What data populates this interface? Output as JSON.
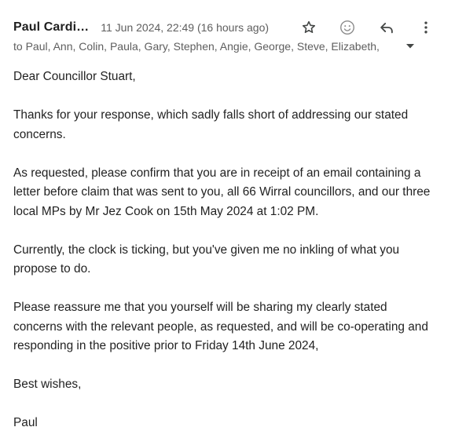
{
  "header": {
    "sender_name": "Paul Cardi…",
    "date": "11 Jun 2024, 22:49 (16 hours ago)",
    "recipients": "to Paul, Ann, Colin, Paula, Gary, Stephen, Angie, George, Steve, Elizabeth,",
    "icons": [
      "star-icon",
      "emoji-reaction-icon",
      "reply-icon",
      "more-options-icon",
      "chevron-down-icon"
    ]
  },
  "message": {
    "greeting": "Dear Councillor Stuart,",
    "paragraphs": [
      "Thanks for your response, which sadly falls short of addressing our stated concerns.",
      "As requested, please confirm that you are in receipt of an email containing a letter before claim that was sent to you, all 66 Wirral councillors, and our three local MPs by Mr Jez Cook on 15th May 2024 at 1:02 PM.",
      "Currently, the clock is ticking, but you've given me no inkling of what you propose to do.",
      "Please reassure me that you yourself will be sharing my clearly stated concerns with the relevant people, as requested, and will be co-operating and responding in the positive prior to Friday 14th June 2024,"
    ],
    "closing": "Best wishes,",
    "signature": "Paul"
  },
  "colors": {
    "text_primary": "#1f1f1f",
    "text_secondary": "#5e5e5e",
    "icon": "#444746"
  }
}
